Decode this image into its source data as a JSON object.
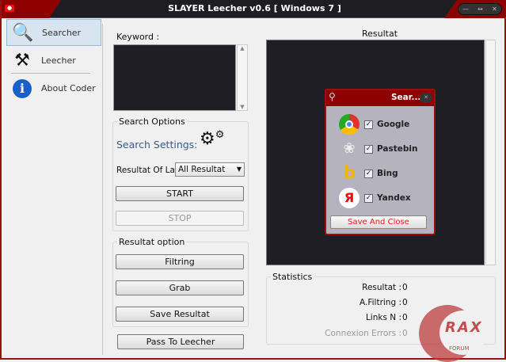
{
  "window": {
    "title": "SLAYER Leecher v0.6 [ Windows 7 ]",
    "controls": [
      "minimize",
      "maximize",
      "close"
    ]
  },
  "sidebar": {
    "items": [
      {
        "label": "Searcher",
        "icon": "magnifier-icon",
        "active": true
      },
      {
        "label": "Leecher",
        "icon": "tools-icon"
      },
      {
        "label": "About Coder",
        "icon": "info-icon"
      }
    ]
  },
  "keyword": {
    "label": "Keyword :",
    "value": ""
  },
  "search_options": {
    "title": "Search Options",
    "settings_label": "Search Settings:",
    "resultat_of_last_label": "Resultat Of Last",
    "resultat_of_last_value": "All Resultat",
    "start": "START",
    "stop": "STOP"
  },
  "resultat_option": {
    "title": "Resultat option",
    "filtring": "Filtring",
    "grab": "Grab",
    "save": "Save Resultat"
  },
  "pass_button": "Pass To Leecher",
  "results": {
    "title": "Resultat"
  },
  "popup": {
    "title": "Sear...",
    "engines": [
      {
        "name": "Google",
        "checked": true
      },
      {
        "name": "Pastebin",
        "checked": true
      },
      {
        "name": "Bing",
        "checked": true
      },
      {
        "name": "Yandex",
        "checked": true
      }
    ],
    "save": "Save And Close"
  },
  "statistics": {
    "title": "Statistics",
    "rows": [
      {
        "label": "Resultat :",
        "value": "0"
      },
      {
        "label": "A.Filtring :",
        "value": "0"
      },
      {
        "label": "Links N :",
        "value": "0"
      },
      {
        "label": "Connexion Errors :",
        "value": "0"
      }
    ]
  },
  "watermark": {
    "text": "RAX",
    "sub": "FORUM"
  },
  "colors": {
    "accent": "#8e0000",
    "dark": "#1e1e24"
  }
}
